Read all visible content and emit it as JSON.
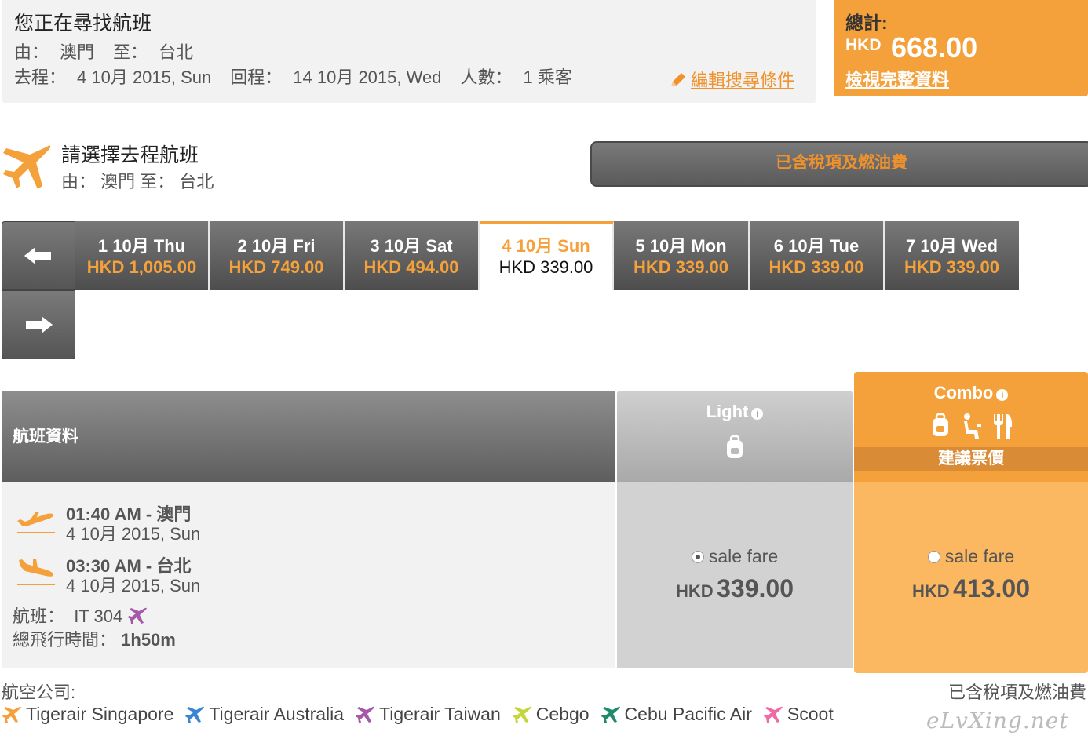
{
  "search": {
    "title": "您正在尋找航班",
    "from_label": "由：",
    "from": "澳門",
    "to_label": "至：",
    "to": "台北",
    "depart_label": "去程：",
    "depart_date": "4 10月 2015, Sun",
    "return_label": "回程：",
    "return_date": "14 10月 2015, Wed",
    "pax_label": "人數：",
    "pax": "1 乘客",
    "edit_label": "編輯搜尋條件"
  },
  "total": {
    "label": "總計:",
    "currency": "HKD",
    "amount": "668.00",
    "details_link": "檢視完整資料"
  },
  "outbound": {
    "title": "請選擇去程航班",
    "route": "由：  澳門 至：  台北",
    "tax_banner": "已含稅項及燃油費"
  },
  "date_tabs": [
    {
      "date": "1 10月 Thu",
      "price": "HKD 1,005.00",
      "active": false
    },
    {
      "date": "2 10月 Fri",
      "price": "HKD 749.00",
      "active": false
    },
    {
      "date": "3 10月 Sat",
      "price": "HKD 494.00",
      "active": false
    },
    {
      "date": "4 10月 Sun",
      "price": "HKD 339.00",
      "active": true
    },
    {
      "date": "5 10月 Mon",
      "price": "HKD 339.00",
      "active": false
    },
    {
      "date": "6 10月 Tue",
      "price": "HKD 339.00",
      "active": false
    },
    {
      "date": "7 10月 Wed",
      "price": "HKD 339.00",
      "active": false
    }
  ],
  "table": {
    "info_header": "航班資料",
    "light_header": "Light",
    "combo_header": "Combo",
    "combo_recommend": "建議票價"
  },
  "flight": {
    "depart_time": "01:40 AM - 澳門",
    "depart_date": "4 10月 2015, Sun",
    "arrive_time": "03:30 AM - 台北",
    "arrive_date": "4 10月 2015, Sun",
    "flight_label": "航班：",
    "flight_no": "IT 304",
    "duration_label": "總飛行時間：",
    "duration": "1h50m"
  },
  "fares": {
    "light": {
      "label": "sale fare",
      "currency": "HKD",
      "amount": "339.00",
      "selected": true
    },
    "combo": {
      "label": "sale fare",
      "currency": "HKD",
      "amount": "413.00",
      "selected": false
    }
  },
  "footer": {
    "airlines_label": "航空公司:",
    "tax_note": "已含稅項及燃油費",
    "airlines": [
      {
        "name": "Tigerair Singapore",
        "color": "#f5a13b"
      },
      {
        "name": "Tigerair Australia",
        "color": "#3a86d4"
      },
      {
        "name": "Tigerair Taiwan",
        "color": "#a45aa8"
      },
      {
        "name": "Cebgo",
        "color": "#c4d63a"
      },
      {
        "name": "Cebu Pacific Air",
        "color": "#1f8a6a"
      },
      {
        "name": "Scoot",
        "color": "#f06aa6"
      }
    ],
    "watermark": "eLvXing.net"
  },
  "colors": {
    "accent": "#f5a13b",
    "dark_tab": "#5a5a5a"
  }
}
